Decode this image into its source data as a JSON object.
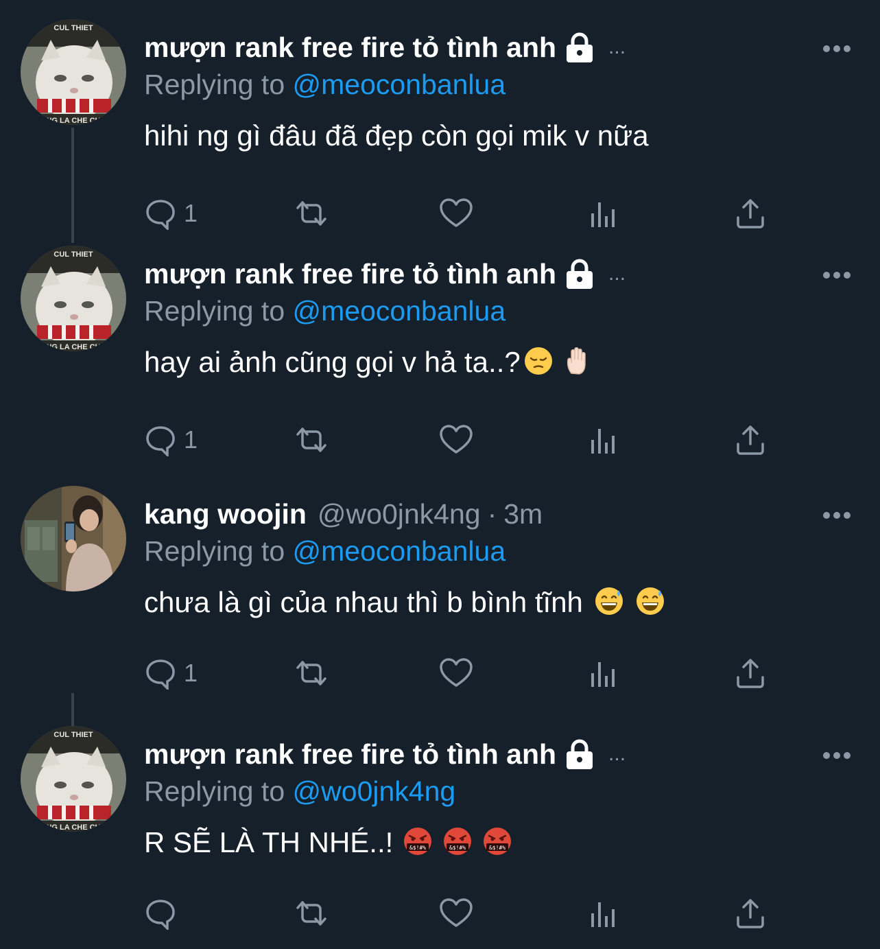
{
  "colors": {
    "background": "#15202b",
    "text_primary": "#ffffff",
    "text_secondary": "#8b98a5",
    "accent": "#1d9bf0",
    "thread_line": "#38444d"
  },
  "tweets": [
    {
      "name": "mượn rank free fire tỏ tình anh",
      "protected": true,
      "ellipsis": "...",
      "replying_prefix": "Replying to",
      "replying_to": "@meoconbanlua",
      "text": "hihi ng gì đâu đã đẹp còn gọi mik v nữa",
      "emojis": [],
      "reply_count": "1",
      "avatar": "white-cat-avatar"
    },
    {
      "name": "mượn rank free fire tỏ tình anh",
      "protected": true,
      "ellipsis": "...",
      "replying_prefix": "Replying to",
      "replying_to": "@meoconbanlua",
      "text": "hay ai ảnh cũng gọi v hả ta..?",
      "emojis": [
        "pensive-face-emoji",
        "raised-hand-emoji"
      ],
      "reply_count": "1",
      "avatar": "white-cat-avatar"
    },
    {
      "name": "kang woojin",
      "handle": "@wo0jnk4ng",
      "separator": "·",
      "time": "3m",
      "replying_prefix": "Replying to",
      "replying_to": "@meoconbanlua",
      "text": "chưa là gì của nhau thì b bình tĩnh",
      "emojis": [
        "grinning-sweat-emoji",
        "grinning-sweat-emoji"
      ],
      "reply_count": "1",
      "avatar": "person-selfie-avatar"
    },
    {
      "name": "mượn rank free fire tỏ tình anh",
      "protected": true,
      "ellipsis": "...",
      "replying_prefix": "Replying to",
      "replying_to": "@wo0jnk4ng",
      "text": "R SẼ LÀ TH NHÉ..!",
      "emojis": [
        "cursing-face-emoji",
        "cursing-face-emoji",
        "cursing-face-emoji"
      ],
      "reply_count": "",
      "avatar": "white-cat-avatar"
    }
  ],
  "action_icons": [
    "reply-icon",
    "retweet-icon",
    "like-icon",
    "analytics-icon",
    "share-icon"
  ]
}
